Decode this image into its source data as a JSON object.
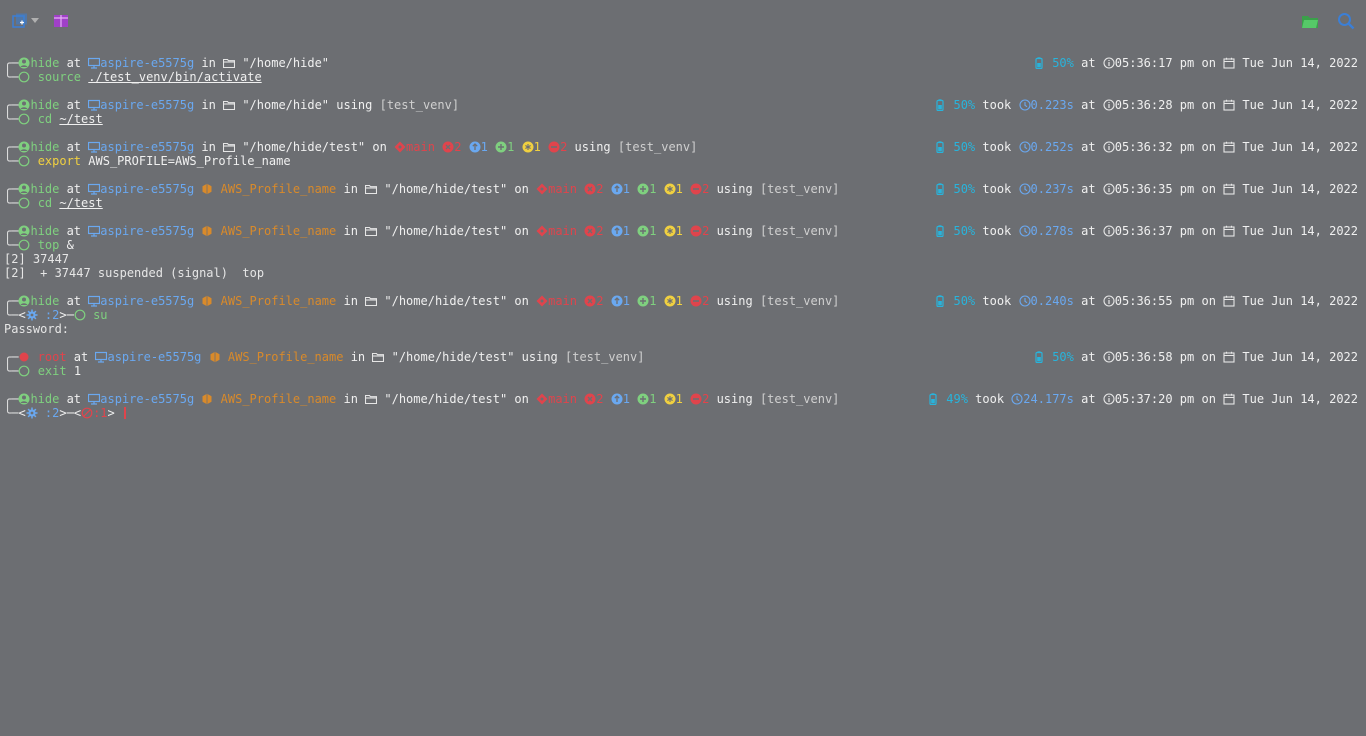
{
  "colors": {
    "background": "#6c6e72",
    "user": "#7fd07f",
    "host": "#6aa8f0",
    "aws": "#d98a2a",
    "git": "#e0444c",
    "battery": "#28b4dc",
    "root": "#e0444c"
  },
  "toolbar": {
    "icons": [
      "new-tab-icon",
      "dropdown-icon",
      "split-view-icon",
      "open-folder-icon",
      "search-icon"
    ]
  },
  "labels": {
    "at": "at",
    "in": "in",
    "on": "on",
    "took": "took",
    "using": "using"
  },
  "blocks": [
    {
      "user": "hide",
      "host": "aspire-e5575g",
      "path": "\"/home/hide\"",
      "venv": "",
      "battery": "50%",
      "took": "",
      "time": "05:36:17 pm",
      "date": "Tue Jun 14, 2022",
      "cmd_name": "source",
      "cmd_arg": "./test_venv/bin/activate",
      "output": []
    },
    {
      "user": "hide",
      "host": "aspire-e5575g",
      "path": "\"/home/hide\"",
      "venv": "[test_venv]",
      "battery": "50%",
      "took": "0.223s",
      "time": "05:36:28 pm",
      "date": "Tue Jun 14, 2022",
      "cmd_name": "cd",
      "cmd_arg": "~/test",
      "output": []
    },
    {
      "user": "hide",
      "host": "aspire-e5575g",
      "path": "\"/home/hide/test\"",
      "git": {
        "branch": "main",
        "a": "2",
        "b": "1",
        "c": "1",
        "d": "1",
        "e": "2"
      },
      "venv": "[test_venv]",
      "battery": "50%",
      "took": "0.252s",
      "time": "05:36:32 pm",
      "date": "Tue Jun 14, 2022",
      "cmd_name": "export",
      "cmd_arg": "AWS_PROFILE=AWS_Profile_name",
      "output": []
    },
    {
      "user": "hide",
      "host": "aspire-e5575g",
      "aws": "AWS_Profile_name",
      "path": "\"/home/hide/test\"",
      "git": {
        "branch": "main",
        "a": "2",
        "b": "1",
        "c": "1",
        "d": "1",
        "e": "2"
      },
      "venv": "[test_venv]",
      "battery": "50%",
      "took": "0.237s",
      "time": "05:36:35 pm",
      "date": "Tue Jun 14, 2022",
      "cmd_name": "cd",
      "cmd_arg": "~/test",
      "output": []
    },
    {
      "user": "hide",
      "host": "aspire-e5575g",
      "aws": "AWS_Profile_name",
      "path": "\"/home/hide/test\"",
      "git": {
        "branch": "main",
        "a": "2",
        "b": "1",
        "c": "1",
        "d": "1",
        "e": "2"
      },
      "venv": "[test_venv]",
      "battery": "50%",
      "took": "0.278s",
      "time": "05:36:37 pm",
      "date": "Tue Jun 14, 2022",
      "cmd_name": "top",
      "cmd_arg": "&",
      "output": [
        "[2] 37447",
        "[2]  + 37447 suspended (signal)  top"
      ]
    },
    {
      "user": "hide",
      "host": "aspire-e5575g",
      "aws": "AWS_Profile_name",
      "path": "\"/home/hide/test\"",
      "git": {
        "branch": "main",
        "a": "2",
        "b": "1",
        "c": "1",
        "d": "1",
        "e": "2"
      },
      "venv": "[test_venv]",
      "battery": "50%",
      "took": "0.240s",
      "time": "05:36:55 pm",
      "date": "Tue Jun 14, 2022",
      "jobs": ":2",
      "cmd_name": "su",
      "cmd_arg": "",
      "output": [
        "Password:"
      ]
    },
    {
      "user": "root",
      "root": true,
      "host": "aspire-e5575g",
      "aws": "AWS_Profile_name",
      "path": "\"/home/hide/test\"",
      "venv": "[test_venv]",
      "battery": "50%",
      "took": "",
      "time": "05:36:58 pm",
      "date": "Tue Jun 14, 2022",
      "cmd_name": "exit",
      "cmd_arg": "1",
      "output": []
    },
    {
      "user": "hide",
      "host": "aspire-e5575g",
      "aws": "AWS_Profile_name",
      "path": "\"/home/hide/test\"",
      "git": {
        "branch": "main",
        "a": "2",
        "b": "1",
        "c": "1",
        "d": "1",
        "e": "2"
      },
      "venv": "[test_venv]",
      "battery": "49%",
      "took": "24.177s",
      "time": "05:37:20 pm",
      "date": "Tue Jun 14, 2022",
      "jobs": ":2",
      "exit_code": ":1",
      "cmd_name": "",
      "cmd_arg": "",
      "active": true,
      "output": []
    }
  ]
}
